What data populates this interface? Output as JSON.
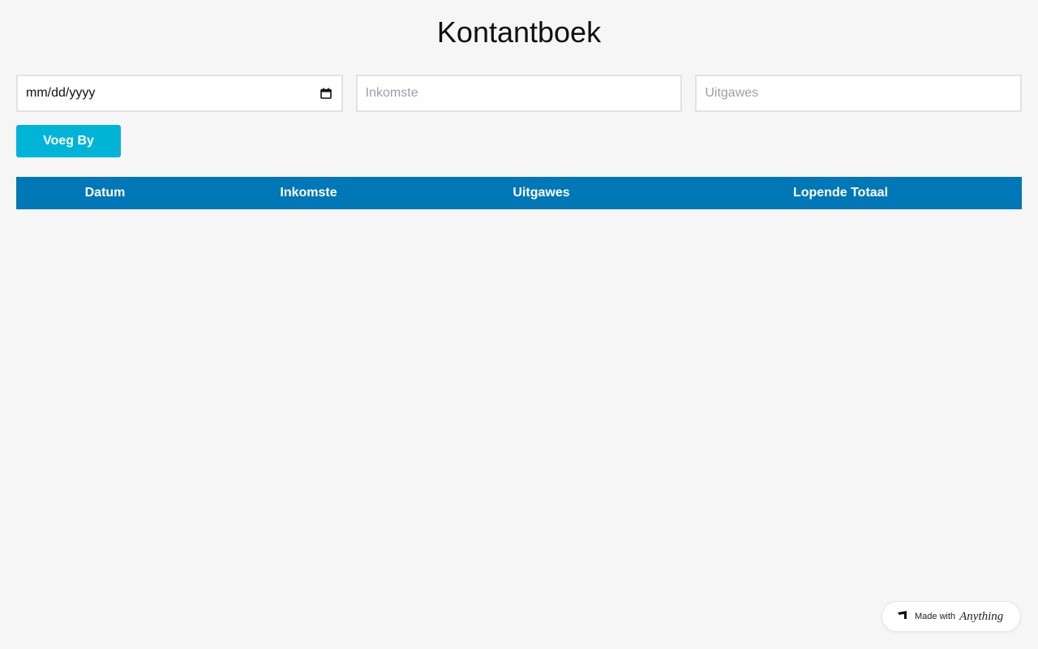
{
  "app": {
    "title": "Kontantboek"
  },
  "form": {
    "date_value": "mm/dd/yyyy",
    "income_placeholder": "Inkomste",
    "expense_placeholder": "Uitgawes",
    "add_label": "Voeg By"
  },
  "table": {
    "headers": [
      "Datum",
      "Inkomste",
      "Uitgawes",
      "Lopende Totaal"
    ],
    "rows": []
  },
  "badge": {
    "text": "Made with",
    "brand": "Anything"
  },
  "colors": {
    "background": "#f6f6f6",
    "button": "#00b4d8",
    "table_header": "#0077b6"
  },
  "icons": {
    "date": "calendar-icon",
    "badge": "anything-logo-icon"
  }
}
